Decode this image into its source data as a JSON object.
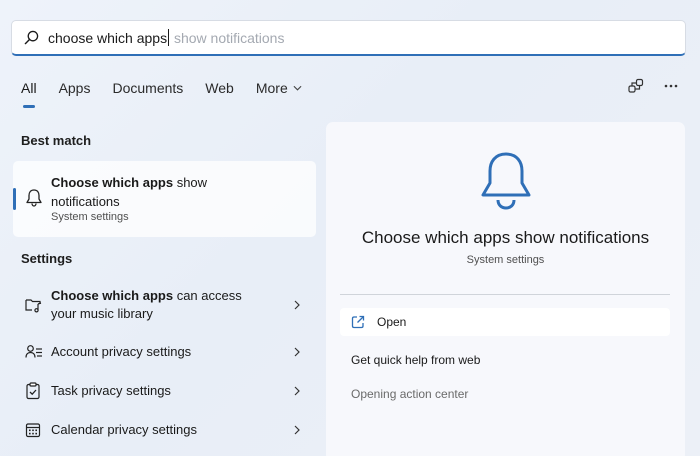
{
  "search": {
    "typed": "choose which apps",
    "suggestion": " show notifications"
  },
  "tabs": [
    {
      "label": "All"
    },
    {
      "label": "Apps"
    },
    {
      "label": "Documents"
    },
    {
      "label": "Web"
    },
    {
      "label": "More"
    }
  ],
  "best_match": {
    "heading": "Best match",
    "title_bold": "Choose which apps",
    "title_rest": " show notifications",
    "subtitle": "System settings"
  },
  "settings": {
    "heading": "Settings",
    "items": [
      {
        "bold": "Choose which apps",
        "rest": " can access your music library"
      },
      {
        "bold": "",
        "rest": "Account privacy settings"
      },
      {
        "bold": "",
        "rest": "Task privacy settings"
      },
      {
        "bold": "",
        "rest": "Calendar privacy settings"
      }
    ]
  },
  "detail": {
    "title": "Choose which apps show notifications",
    "subtitle": "System settings",
    "open_label": "Open",
    "help_label": "Get quick help from web",
    "opening_label": "Opening action center"
  },
  "icons": {
    "search": "search-icon",
    "chevron": "chevron-down-icon",
    "share": "share-icon",
    "more": "more-icon",
    "bell": "bell-icon",
    "music": "music-folder-icon",
    "account": "account-icon",
    "task": "clipboard-icon",
    "calendar": "calendar-icon",
    "open": "open-external-icon"
  },
  "colors": {
    "accent": "#2f6fb7"
  }
}
